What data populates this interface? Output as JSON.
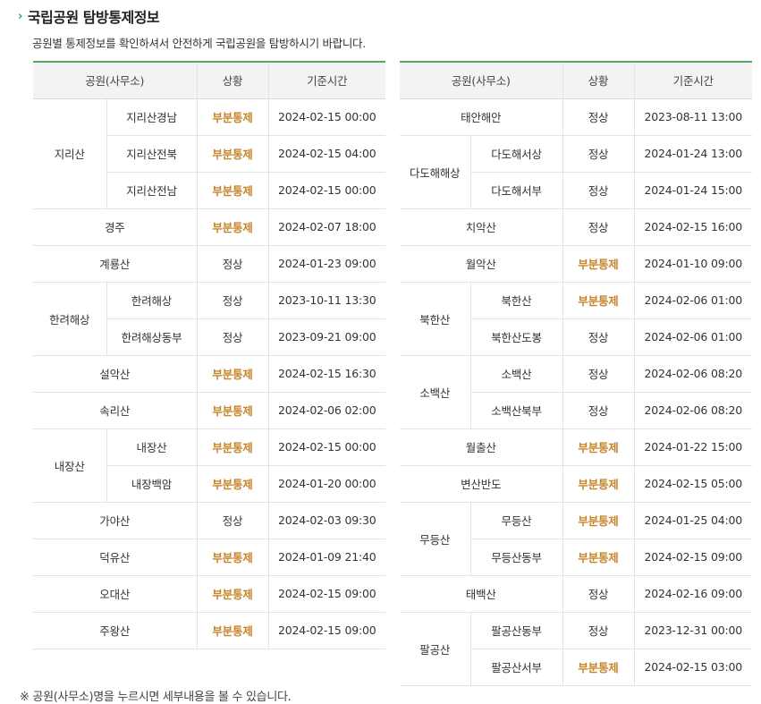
{
  "page": {
    "title": "국립공원 탐방통제정보",
    "subtitle": "공원별 통제정보를 확인하셔서 안전하게 국립공원을 탐방하시기 바랍니다.",
    "note": "※ 공원(사무소)명을 누르시면 세부내용을 볼 수 있습니다."
  },
  "headers": {
    "park": "공원(사무소)",
    "status": "상황",
    "time": "기준시간"
  },
  "status_colors": {
    "부분통제": "#c7852b",
    "정상": "#333333"
  },
  "left_table": [
    {
      "type": "group",
      "name": "지리산",
      "subs": [
        {
          "name": "지리산경남",
          "status": "부분통제",
          "time": "2024-02-15 00:00"
        },
        {
          "name": "지리산전북",
          "status": "부분통제",
          "time": "2024-02-15 04:00"
        },
        {
          "name": "지리산전남",
          "status": "부분통제",
          "time": "2024-02-15 00:00"
        }
      ]
    },
    {
      "type": "single",
      "name": "경주",
      "status": "부분통제",
      "time": "2024-02-07 18:00"
    },
    {
      "type": "single",
      "name": "계룡산",
      "status": "정상",
      "time": "2024-01-23 09:00"
    },
    {
      "type": "group",
      "name": "한려해상",
      "subs": [
        {
          "name": "한려해상",
          "status": "정상",
          "time": "2023-10-11 13:30"
        },
        {
          "name": "한려해상동부",
          "status": "정상",
          "time": "2023-09-21 09:00"
        }
      ]
    },
    {
      "type": "single",
      "name": "설악산",
      "status": "부분통제",
      "time": "2024-02-15 16:30"
    },
    {
      "type": "single",
      "name": "속리산",
      "status": "부분통제",
      "time": "2024-02-06 02:00"
    },
    {
      "type": "group",
      "name": "내장산",
      "subs": [
        {
          "name": "내장산",
          "status": "부분통제",
          "time": "2024-02-15 00:00"
        },
        {
          "name": "내장백암",
          "status": "부분통제",
          "time": "2024-01-20 00:00"
        }
      ]
    },
    {
      "type": "single",
      "name": "가야산",
      "status": "정상",
      "time": "2024-02-03 09:30"
    },
    {
      "type": "single",
      "name": "덕유산",
      "status": "부분통제",
      "time": "2024-01-09 21:40"
    },
    {
      "type": "single",
      "name": "오대산",
      "status": "부분통제",
      "time": "2024-02-15 09:00"
    },
    {
      "type": "single",
      "name": "주왕산",
      "status": "부분통제",
      "time": "2024-02-15 09:00"
    }
  ],
  "right_table": [
    {
      "type": "single",
      "name": "태안해안",
      "status": "정상",
      "time": "2023-08-11 13:00"
    },
    {
      "type": "group",
      "name": "다도해해상",
      "subs": [
        {
          "name": "다도해서상",
          "status": "정상",
          "time": "2024-01-24 13:00"
        },
        {
          "name": "다도해서부",
          "status": "정상",
          "time": "2024-01-24 15:00"
        }
      ]
    },
    {
      "type": "single",
      "name": "치악산",
      "status": "정상",
      "time": "2024-02-15 16:00"
    },
    {
      "type": "single",
      "name": "월악산",
      "status": "부분통제",
      "time": "2024-01-10 09:00"
    },
    {
      "type": "group",
      "name": "북한산",
      "subs": [
        {
          "name": "북한산",
          "status": "부분통제",
          "time": "2024-02-06 01:00"
        },
        {
          "name": "북한산도봉",
          "status": "정상",
          "time": "2024-02-06 01:00"
        }
      ]
    },
    {
      "type": "group",
      "name": "소백산",
      "subs": [
        {
          "name": "소백산",
          "status": "정상",
          "time": "2024-02-06 08:20"
        },
        {
          "name": "소백산북부",
          "status": "정상",
          "time": "2024-02-06 08:20"
        }
      ]
    },
    {
      "type": "single",
      "name": "월출산",
      "status": "부분통제",
      "time": "2024-01-22 15:00"
    },
    {
      "type": "single",
      "name": "변산반도",
      "status": "부분통제",
      "time": "2024-02-15 05:00"
    },
    {
      "type": "group",
      "name": "무등산",
      "subs": [
        {
          "name": "무등산",
          "status": "부분통제",
          "time": "2024-01-25 04:00"
        },
        {
          "name": "무등산동부",
          "status": "부분통제",
          "time": "2024-02-15 09:00"
        }
      ]
    },
    {
      "type": "single",
      "name": "태백산",
      "status": "정상",
      "time": "2024-02-16 09:00"
    },
    {
      "type": "group",
      "name": "팔공산",
      "subs": [
        {
          "name": "팔공산동부",
          "status": "정상",
          "time": "2023-12-31 00:00"
        },
        {
          "name": "팔공산서부",
          "status": "부분통제",
          "time": "2024-02-15 03:00"
        }
      ]
    }
  ]
}
